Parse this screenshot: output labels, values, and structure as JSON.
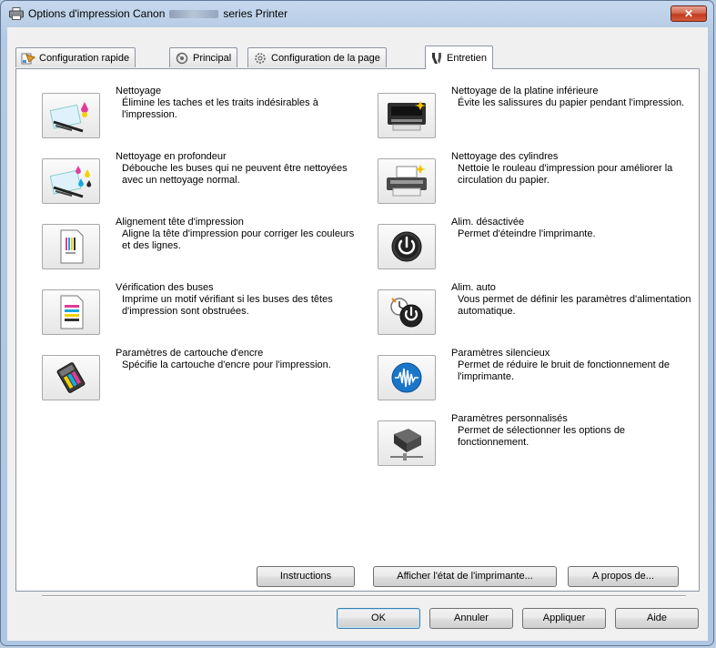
{
  "window": {
    "title_prefix": "Options d'impression Canon",
    "title_suffix": "series Printer",
    "close_label": "✕"
  },
  "tabs": [
    {
      "label": "Configuration rapide",
      "icon": "quick-setup-icon"
    },
    {
      "label": "Principal",
      "icon": "main-icon"
    },
    {
      "label": "Configuration de la page",
      "icon": "page-setup-icon"
    },
    {
      "label": "Entretien",
      "icon": "maintenance-icon",
      "active": true
    }
  ],
  "left_items": [
    {
      "title": "Nettoyage",
      "desc": "Élimine les taches et les traits indésirables à l'impression.",
      "icon": "cleaning-icon"
    },
    {
      "title": "Nettoyage en profondeur",
      "desc": "Débouche les buses qui ne peuvent être nettoyées avec un nettoyage normal.",
      "icon": "deep-cleaning-icon"
    },
    {
      "title": "Alignement tête d'impression",
      "desc": "Aligne la tête d'impression pour corriger les couleurs et des lignes.",
      "icon": "print-head-alignment-icon"
    },
    {
      "title": "Vérification des buses",
      "desc": "Imprime un motif vérifiant si les buses des têtes d'impression sont obstruées.",
      "icon": "nozzle-check-icon"
    },
    {
      "title": "Paramètres de cartouche d'encre",
      "desc": "Spécifie la cartouche d'encre pour l'impression.",
      "icon": "ink-cartridge-icon"
    }
  ],
  "right_items": [
    {
      "title": "Nettoyage de la platine inférieure",
      "desc": "Évite les salissures du papier pendant l'impression.",
      "icon": "bottom-plate-cleaning-icon"
    },
    {
      "title": "Nettoyage des cylindres",
      "desc": "Nettoie le rouleau d'impression pour améliorer la circulation du papier.",
      "icon": "roller-cleaning-icon"
    },
    {
      "title": "Alim. désactivée",
      "desc": "Permet d'éteindre l'imprimante.",
      "icon": "power-off-icon"
    },
    {
      "title": "Alim. auto",
      "desc": "Vous permet de définir les paramètres d'alimentation automatique.",
      "icon": "auto-power-icon"
    },
    {
      "title": "Paramètres silencieux",
      "desc": "Permet de réduire le bruit de fonctionnement de l'imprimante.",
      "icon": "quiet-settings-icon"
    },
    {
      "title": "Paramètres personnalisés",
      "desc": "Permet de sélectionner les options de fonctionnement.",
      "icon": "custom-settings-icon"
    }
  ],
  "panel_buttons": {
    "instructions": "Instructions",
    "status": "Afficher l'état de l'imprimante...",
    "about": "A propos de..."
  },
  "dialog_buttons": {
    "ok": "OK",
    "cancel": "Annuler",
    "apply": "Appliquer",
    "help": "Aide"
  }
}
